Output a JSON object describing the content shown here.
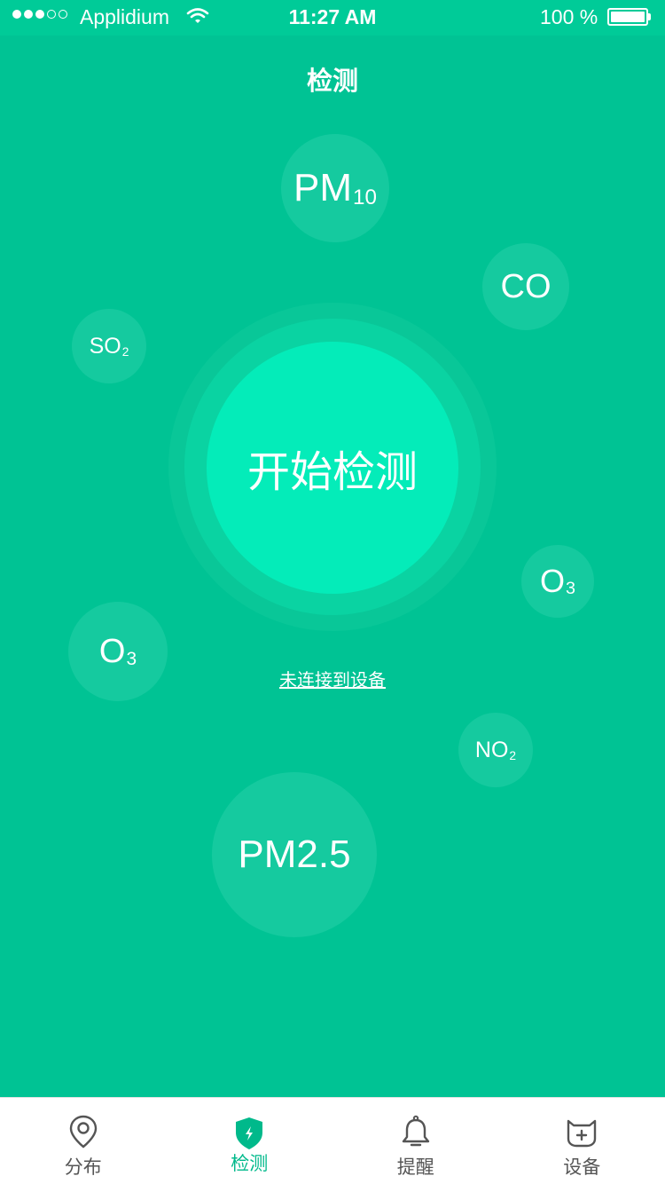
{
  "status_bar": {
    "carrier": "Applidium",
    "time": "11:27 AM",
    "battery": "100 %",
    "signal_bars": 3,
    "signal_total": 5
  },
  "header": {
    "title": "检测"
  },
  "pollutants": [
    {
      "name": "pm10",
      "main": "PM",
      "sub": "10"
    },
    {
      "name": "co",
      "main": "CO",
      "sub": ""
    },
    {
      "name": "so2",
      "main": "SO",
      "sub": "2"
    },
    {
      "name": "o3-right",
      "main": "O",
      "sub": "3"
    },
    {
      "name": "o3-left",
      "main": "O",
      "sub": "3"
    },
    {
      "name": "no2",
      "main": "NO",
      "sub": "2"
    },
    {
      "name": "pm25",
      "main": "PM2.5",
      "sub": ""
    }
  ],
  "main": {
    "start_label": "开始检测",
    "device_status": "未连接到设备"
  },
  "tabs": [
    {
      "label": "分布",
      "icon": "location-pin-icon"
    },
    {
      "label": "检测",
      "icon": "shield-bolt-icon"
    },
    {
      "label": "提醒",
      "icon": "bell-icon"
    },
    {
      "label": "设备",
      "icon": "device-icon"
    }
  ],
  "colors": {
    "background": "#00c394",
    "button": "#04ecb9",
    "active_tab": "#00b98b",
    "inactive_tab": "#555555"
  }
}
